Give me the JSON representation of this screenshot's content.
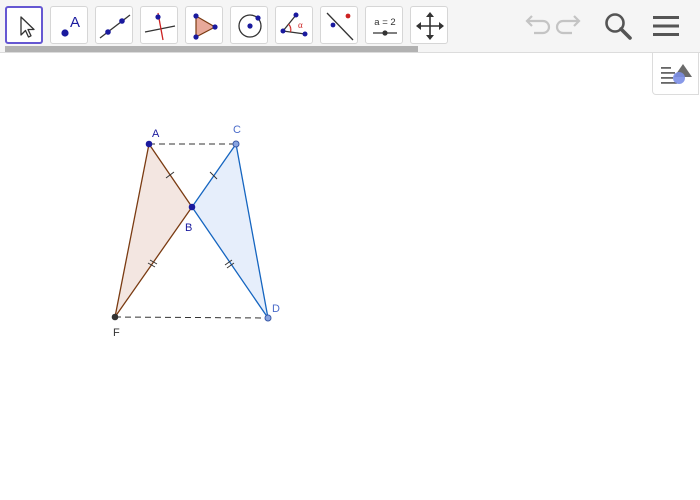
{
  "toolbar": {
    "tools": [
      {
        "name": "move-tool",
        "label": ""
      },
      {
        "name": "point-tool",
        "label": "A"
      },
      {
        "name": "line-tool",
        "label": ""
      },
      {
        "name": "perpendicular-line-tool",
        "label": ""
      },
      {
        "name": "polygon-tool",
        "label": ""
      },
      {
        "name": "circle-tool",
        "label": ""
      },
      {
        "name": "angle-tool",
        "label": "α"
      },
      {
        "name": "reflect-tool",
        "label": ""
      },
      {
        "name": "slider-tool",
        "label": "a = 2"
      },
      {
        "name": "move-graphics-view-tool",
        "label": ""
      }
    ],
    "selected_tool": "move-tool",
    "right_icons": [
      "undo-icon",
      "redo-icon",
      "search-icon",
      "menu-icon"
    ],
    "scrollbar_position": 0.59
  },
  "style_bar": {
    "icon": "style-bar-icon"
  },
  "construction": {
    "points": [
      {
        "id": "A",
        "label": "A",
        "color": "#1a1a9e"
      },
      {
        "id": "B",
        "label": "B",
        "color": "#1a1a9e"
      },
      {
        "id": "C",
        "label": "C",
        "color": "#4a6bc9"
      },
      {
        "id": "D",
        "label": "D",
        "color": "#4a6bc9"
      },
      {
        "id": "F",
        "label": "F",
        "color": "#333333"
      }
    ],
    "triangles": [
      {
        "name": "triangle-ABF",
        "vertices": [
          "A",
          "B",
          "F"
        ],
        "stroke": "#7a3b12",
        "fill": "#f1e2dc"
      },
      {
        "name": "triangle-CBD",
        "vertices": [
          "C",
          "B",
          "D"
        ],
        "stroke": "#1565c0",
        "fill": "#e3ecfb"
      }
    ],
    "dashed_segments": [
      [
        "A",
        "C"
      ],
      [
        "F",
        "D"
      ]
    ],
    "tick_marks": {
      "single": [
        [
          "A",
          "B"
        ],
        [
          "B",
          "C"
        ]
      ],
      "double": [
        [
          "B",
          "F"
        ],
        [
          "B",
          "D"
        ]
      ]
    }
  }
}
